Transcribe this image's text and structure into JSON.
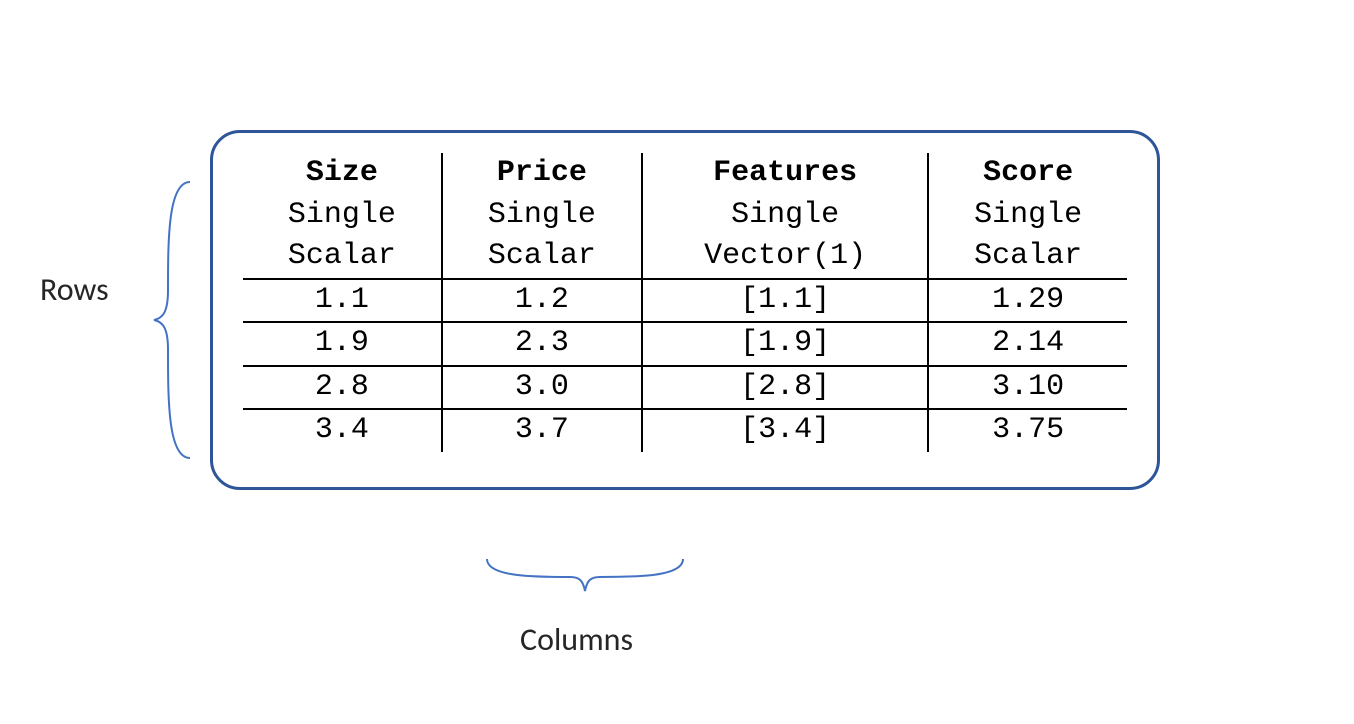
{
  "labels": {
    "rows": "Rows",
    "columns": "Columns"
  },
  "columns": [
    {
      "name": "Size",
      "cardinality": "Single",
      "dtype": "Scalar"
    },
    {
      "name": "Price",
      "cardinality": "Single",
      "dtype": "Scalar"
    },
    {
      "name": "Features",
      "cardinality": "Single",
      "dtype": "Vector(1)"
    },
    {
      "name": "Score",
      "cardinality": "Single",
      "dtype": "Scalar"
    }
  ],
  "rows": [
    {
      "Size": "1.1",
      "Price": "1.2",
      "Features": "[1.1]",
      "Score": "1.29"
    },
    {
      "Size": "1.9",
      "Price": "2.3",
      "Features": "[1.9]",
      "Score": "2.14"
    },
    {
      "Size": "2.8",
      "Price": "3.0",
      "Features": "[2.8]",
      "Score": "3.10"
    },
    {
      "Size": "3.4",
      "Price": "3.7",
      "Features": "[3.4]",
      "Score": "3.75"
    }
  ],
  "chart_data": {
    "type": "table",
    "title": "",
    "columns": [
      "Size",
      "Price",
      "Features",
      "Score"
    ],
    "column_types": {
      "Size": {
        "cardinality": "Single",
        "dtype": "Scalar"
      },
      "Price": {
        "cardinality": "Single",
        "dtype": "Scalar"
      },
      "Features": {
        "cardinality": "Single",
        "dtype": "Vector(1)"
      },
      "Score": {
        "cardinality": "Single",
        "dtype": "Scalar"
      }
    },
    "data": [
      {
        "Size": 1.1,
        "Price": 1.2,
        "Features": [
          1.1
        ],
        "Score": 1.29
      },
      {
        "Size": 1.9,
        "Price": 2.3,
        "Features": [
          1.9
        ],
        "Score": 2.14
      },
      {
        "Size": 2.8,
        "Price": 3.0,
        "Features": [
          2.8
        ],
        "Score": 3.1
      },
      {
        "Size": 3.4,
        "Price": 3.7,
        "Features": [
          3.4
        ],
        "Score": 3.75
      }
    ],
    "row_axis_label": "Rows",
    "column_axis_label": "Columns"
  },
  "colors": {
    "box_border": "#2E5597",
    "brace": "#4472C4",
    "text": "#000000"
  }
}
